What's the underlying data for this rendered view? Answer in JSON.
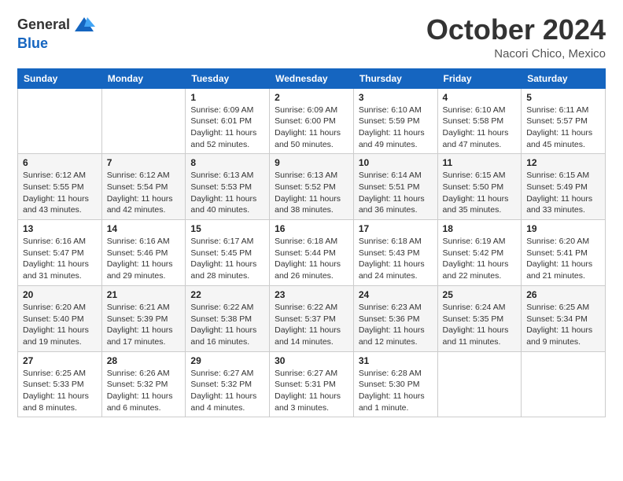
{
  "header": {
    "logo_general": "General",
    "logo_blue": "Blue",
    "title": "October 2024",
    "subtitle": "Nacori Chico, Mexico"
  },
  "calendar": {
    "days": [
      "Sunday",
      "Monday",
      "Tuesday",
      "Wednesday",
      "Thursday",
      "Friday",
      "Saturday"
    ],
    "weeks": [
      [
        {
          "date": "",
          "info": ""
        },
        {
          "date": "",
          "info": ""
        },
        {
          "date": "1",
          "info": "Sunrise: 6:09 AM\nSunset: 6:01 PM\nDaylight: 11 hours and 52 minutes."
        },
        {
          "date": "2",
          "info": "Sunrise: 6:09 AM\nSunset: 6:00 PM\nDaylight: 11 hours and 50 minutes."
        },
        {
          "date": "3",
          "info": "Sunrise: 6:10 AM\nSunset: 5:59 PM\nDaylight: 11 hours and 49 minutes."
        },
        {
          "date": "4",
          "info": "Sunrise: 6:10 AM\nSunset: 5:58 PM\nDaylight: 11 hours and 47 minutes."
        },
        {
          "date": "5",
          "info": "Sunrise: 6:11 AM\nSunset: 5:57 PM\nDaylight: 11 hours and 45 minutes."
        }
      ],
      [
        {
          "date": "6",
          "info": "Sunrise: 6:12 AM\nSunset: 5:55 PM\nDaylight: 11 hours and 43 minutes."
        },
        {
          "date": "7",
          "info": "Sunrise: 6:12 AM\nSunset: 5:54 PM\nDaylight: 11 hours and 42 minutes."
        },
        {
          "date": "8",
          "info": "Sunrise: 6:13 AM\nSunset: 5:53 PM\nDaylight: 11 hours and 40 minutes."
        },
        {
          "date": "9",
          "info": "Sunrise: 6:13 AM\nSunset: 5:52 PM\nDaylight: 11 hours and 38 minutes."
        },
        {
          "date": "10",
          "info": "Sunrise: 6:14 AM\nSunset: 5:51 PM\nDaylight: 11 hours and 36 minutes."
        },
        {
          "date": "11",
          "info": "Sunrise: 6:15 AM\nSunset: 5:50 PM\nDaylight: 11 hours and 35 minutes."
        },
        {
          "date": "12",
          "info": "Sunrise: 6:15 AM\nSunset: 5:49 PM\nDaylight: 11 hours and 33 minutes."
        }
      ],
      [
        {
          "date": "13",
          "info": "Sunrise: 6:16 AM\nSunset: 5:47 PM\nDaylight: 11 hours and 31 minutes."
        },
        {
          "date": "14",
          "info": "Sunrise: 6:16 AM\nSunset: 5:46 PM\nDaylight: 11 hours and 29 minutes."
        },
        {
          "date": "15",
          "info": "Sunrise: 6:17 AM\nSunset: 5:45 PM\nDaylight: 11 hours and 28 minutes."
        },
        {
          "date": "16",
          "info": "Sunrise: 6:18 AM\nSunset: 5:44 PM\nDaylight: 11 hours and 26 minutes."
        },
        {
          "date": "17",
          "info": "Sunrise: 6:18 AM\nSunset: 5:43 PM\nDaylight: 11 hours and 24 minutes."
        },
        {
          "date": "18",
          "info": "Sunrise: 6:19 AM\nSunset: 5:42 PM\nDaylight: 11 hours and 22 minutes."
        },
        {
          "date": "19",
          "info": "Sunrise: 6:20 AM\nSunset: 5:41 PM\nDaylight: 11 hours and 21 minutes."
        }
      ],
      [
        {
          "date": "20",
          "info": "Sunrise: 6:20 AM\nSunset: 5:40 PM\nDaylight: 11 hours and 19 minutes."
        },
        {
          "date": "21",
          "info": "Sunrise: 6:21 AM\nSunset: 5:39 PM\nDaylight: 11 hours and 17 minutes."
        },
        {
          "date": "22",
          "info": "Sunrise: 6:22 AM\nSunset: 5:38 PM\nDaylight: 11 hours and 16 minutes."
        },
        {
          "date": "23",
          "info": "Sunrise: 6:22 AM\nSunset: 5:37 PM\nDaylight: 11 hours and 14 minutes."
        },
        {
          "date": "24",
          "info": "Sunrise: 6:23 AM\nSunset: 5:36 PM\nDaylight: 11 hours and 12 minutes."
        },
        {
          "date": "25",
          "info": "Sunrise: 6:24 AM\nSunset: 5:35 PM\nDaylight: 11 hours and 11 minutes."
        },
        {
          "date": "26",
          "info": "Sunrise: 6:25 AM\nSunset: 5:34 PM\nDaylight: 11 hours and 9 minutes."
        }
      ],
      [
        {
          "date": "27",
          "info": "Sunrise: 6:25 AM\nSunset: 5:33 PM\nDaylight: 11 hours and 8 minutes."
        },
        {
          "date": "28",
          "info": "Sunrise: 6:26 AM\nSunset: 5:32 PM\nDaylight: 11 hours and 6 minutes."
        },
        {
          "date": "29",
          "info": "Sunrise: 6:27 AM\nSunset: 5:32 PM\nDaylight: 11 hours and 4 minutes."
        },
        {
          "date": "30",
          "info": "Sunrise: 6:27 AM\nSunset: 5:31 PM\nDaylight: 11 hours and 3 minutes."
        },
        {
          "date": "31",
          "info": "Sunrise: 6:28 AM\nSunset: 5:30 PM\nDaylight: 11 hours and 1 minute."
        },
        {
          "date": "",
          "info": ""
        },
        {
          "date": "",
          "info": ""
        }
      ]
    ]
  }
}
